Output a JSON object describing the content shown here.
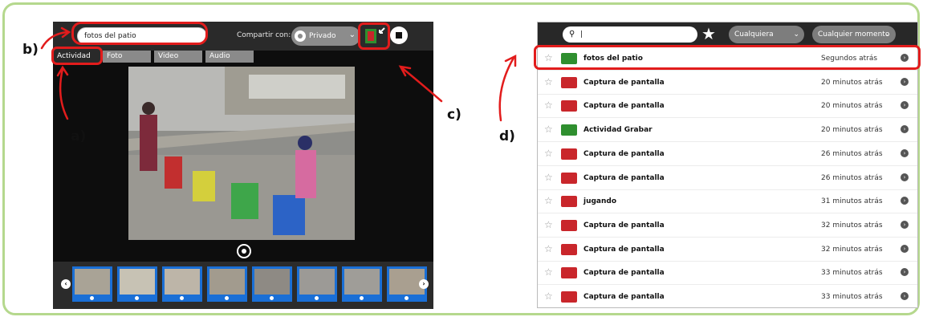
{
  "annotations": {
    "a": "a)",
    "b": "b)",
    "c": "c)",
    "d": "d)"
  },
  "record": {
    "title_value": "fotos del patio",
    "share_label": "Compartir con:",
    "share_value": "Privado",
    "tabs": [
      "Actividad",
      "Foto",
      "Video",
      "Audio"
    ],
    "thumbnail_count": 8
  },
  "journal": {
    "search_value": "|",
    "filter_type": "Cualquiera",
    "filter_time": "Cualquier momento",
    "entries": [
      {
        "name": "fotos del patio",
        "time": "Segundos atrás"
      },
      {
        "name": "Captura de pantalla",
        "time": "20 minutos atrás"
      },
      {
        "name": "Captura de pantalla",
        "time": "20 minutos atrás"
      },
      {
        "name": "Actividad Grabar",
        "time": "20 minutos atrás"
      },
      {
        "name": "Captura de pantalla",
        "time": "26 minutos atrás"
      },
      {
        "name": "Captura de pantalla",
        "time": "26 minutos atrás"
      },
      {
        "name": "jugando",
        "time": "31 minutos atrás"
      },
      {
        "name": "Captura de pantalla",
        "time": "32 minutos atrás"
      },
      {
        "name": "Captura de pantalla",
        "time": "32 minutos atrás"
      },
      {
        "name": "Captura de pantalla",
        "time": "33 minutos atrás"
      },
      {
        "name": "Captura de pantalla",
        "time": "33 minutos atrás"
      }
    ]
  },
  "colors": {
    "frame_border": "#b5d88d",
    "annotation_red": "#e21c1c",
    "thumb_blue": "#1a6fd6"
  }
}
